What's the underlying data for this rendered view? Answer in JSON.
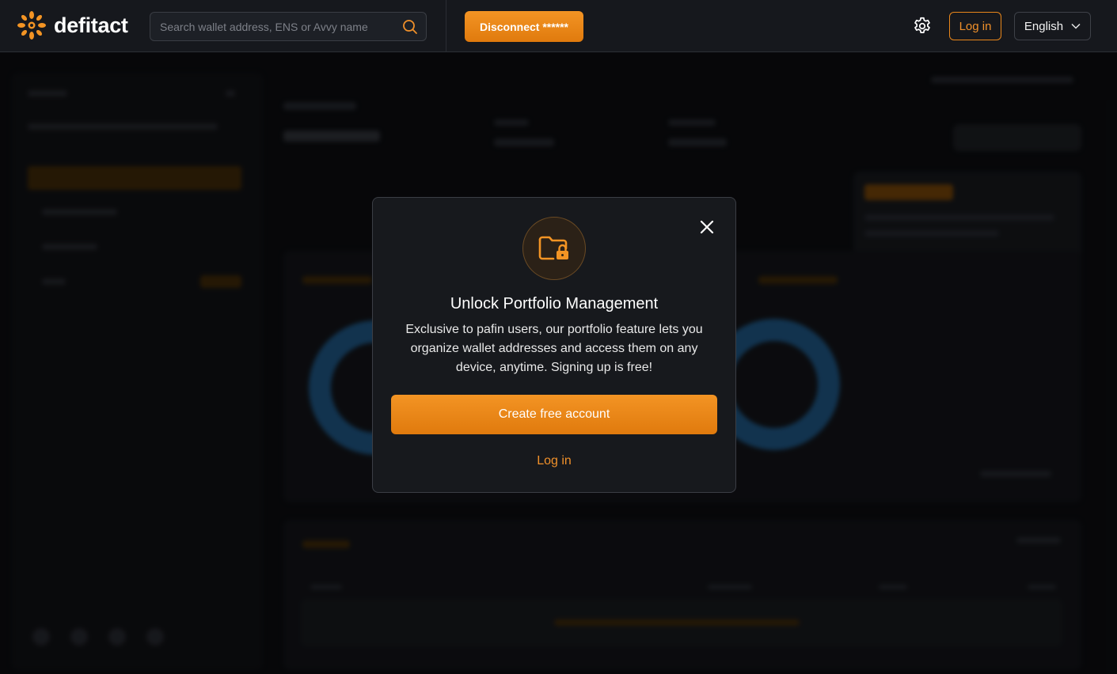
{
  "header": {
    "brand": "defitact",
    "search_placeholder": "Search wallet address, ENS or Avvy name",
    "disconnect_label": "Disconnect ******",
    "login_label": "Log in",
    "language_label": "English"
  },
  "modal": {
    "title": "Unlock Portfolio Management",
    "description": "Exclusive to pafin users, our portfolio feature lets you organize wallet addresses and access them on any device, anytime. Signing up is free!",
    "primary_button": "Create free account",
    "secondary_link": "Log in"
  },
  "icons": {
    "logo": "defitact-logo-icon",
    "search": "search-icon",
    "settings": "gear-icon",
    "dropdown": "chevron-down-icon",
    "close": "close-icon",
    "lock": "folder-lock-icon"
  },
  "colors": {
    "accent": "#f0902a",
    "accent_button": "#e8861a",
    "background": "#0b0c0f",
    "modal_bg": "#17191d",
    "donut": "#1c4f79"
  }
}
